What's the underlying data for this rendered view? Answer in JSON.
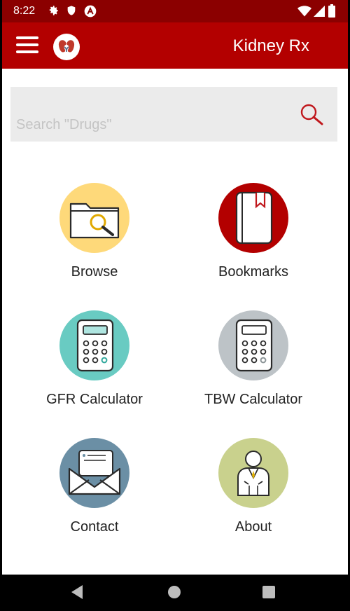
{
  "status_bar": {
    "time": "8:22",
    "icons": [
      "gear-icon",
      "shield-icon",
      "a-badge-icon",
      "wifi-icon",
      "signal-icon",
      "battery-icon"
    ]
  },
  "app_bar": {
    "title": "Kidney Rx",
    "menu_icon": "hamburger-menu-icon",
    "logo_icon": "kidney-logo-icon"
  },
  "search": {
    "placeholder": "Search \"Drugs\"",
    "value": ""
  },
  "tiles": [
    {
      "label": "Browse",
      "icon": "folder-search-icon",
      "color": "#fed97a"
    },
    {
      "label": "Bookmarks",
      "icon": "bookmark-book-icon",
      "color": "#b30000"
    },
    {
      "label": "GFR Calculator",
      "icon": "calculator-icon",
      "color": "#69cbc2"
    },
    {
      "label": "TBW Calculator",
      "icon": "calculator-icon",
      "color": "#bdc3c7"
    },
    {
      "label": "Contact",
      "icon": "envelope-icon",
      "color": "#6b8fa5"
    },
    {
      "label": "About",
      "icon": "doctor-icon",
      "color": "#c9d18d"
    }
  ],
  "nav_bar": {
    "icons": [
      "back-icon",
      "home-icon",
      "recents-icon"
    ]
  },
  "colors": {
    "status_bar": "#8b0000",
    "app_bar": "#b30000",
    "search_bg": "#ebebeb"
  }
}
